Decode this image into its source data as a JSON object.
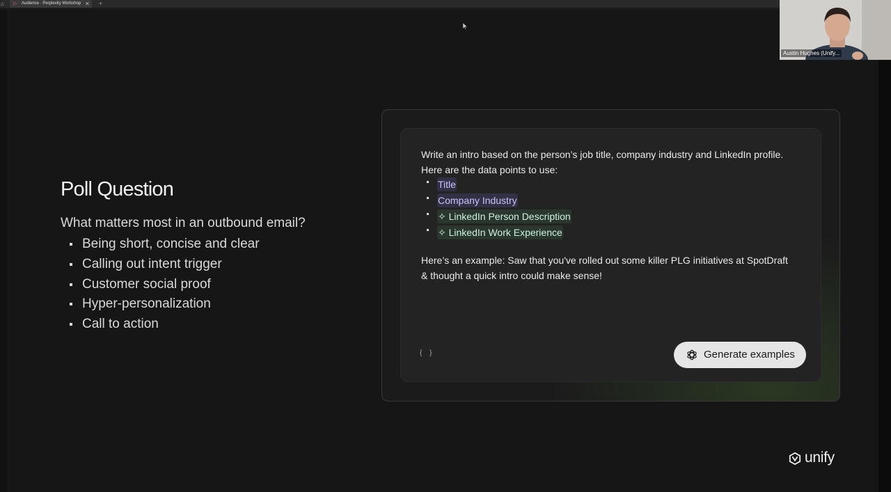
{
  "browser": {
    "home_icon": "home-icon",
    "tab_title": "Audience · Perplexity Workshop",
    "new_tab": "+"
  },
  "poll": {
    "title": "Poll Question",
    "question": "What matters most in an outbound email?",
    "options": [
      "Being short, concise and clear",
      "Calling out intent trigger",
      "Customer social proof",
      "Hyper-personalization",
      "Call to action"
    ]
  },
  "prompt_card": {
    "intro": "Write an intro based on the person’s job title, company industry and LinkedIn profile. Here are the data points to use:",
    "data_points": [
      {
        "label": "Title",
        "style": "purple"
      },
      {
        "label": "Company Industry",
        "style": "purple"
      },
      {
        "label": "✧ LinkedIn Person Description",
        "style": "green"
      },
      {
        "label": "✧ LinkedIn Work Experience",
        "style": "green"
      }
    ],
    "example": "Here’s an example: Saw that you've rolled out some killer PLG initiatives at SpotDraft & thought a quick intro could make sense!",
    "braces": "{ }",
    "generate_label": "Generate examples"
  },
  "brand": {
    "name": "unify"
  },
  "webcam": {
    "participant": "Austin Hughes (Unify..."
  },
  "colors": {
    "background": "#161616",
    "chip_purple": "#c9c2ff",
    "chip_green": "#cdf2dc",
    "button": "#e5e5e5"
  }
}
